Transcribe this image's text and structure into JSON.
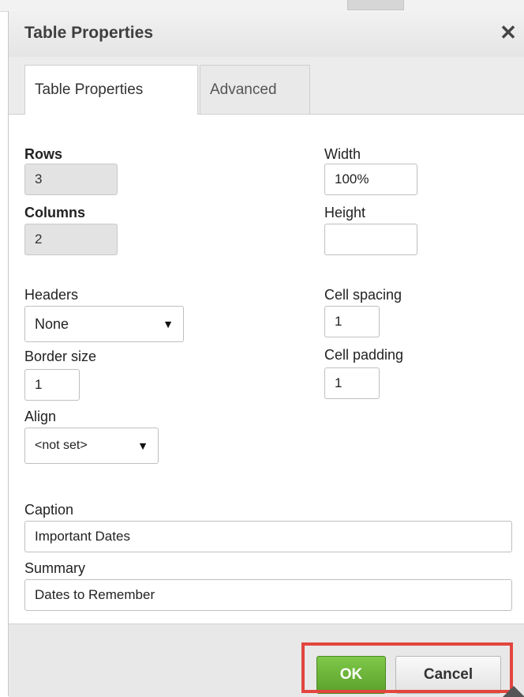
{
  "dialog": {
    "title": "Table Properties",
    "close_icon": "close-icon"
  },
  "tabs": [
    {
      "label": "Table Properties",
      "active": true
    },
    {
      "label": "Advanced",
      "active": false
    }
  ],
  "form": {
    "rows_label": "Rows",
    "rows_value": "3",
    "columns_label": "Columns",
    "columns_value": "2",
    "width_label": "Width",
    "width_value": "100%",
    "height_label": "Height",
    "height_value": "",
    "headers_label": "Headers",
    "headers_value": "None",
    "cell_spacing_label": "Cell spacing",
    "cell_spacing_value": "1",
    "border_size_label": "Border size",
    "border_size_value": "1",
    "cell_padding_label": "Cell padding",
    "cell_padding_value": "1",
    "align_label": "Align",
    "align_value": "<not set>",
    "caption_label": "Caption",
    "caption_value": "Important Dates",
    "summary_label": "Summary",
    "summary_value": "Dates to Remember"
  },
  "footer": {
    "ok_label": "OK",
    "cancel_label": "Cancel"
  },
  "colors": {
    "ok_button": "#5aa12a",
    "highlight": "#e2463e"
  }
}
